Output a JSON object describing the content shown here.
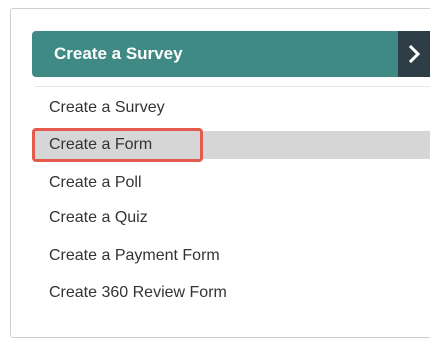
{
  "dropdown": {
    "selected_label": "Create a Survey",
    "toggle_icon": "chevron-right-icon",
    "button_color": "#3f8a84",
    "toggle_color": "#2f3e46"
  },
  "menu": {
    "items": [
      {
        "label": "Create a Survey"
      },
      {
        "label": "Create a Form",
        "selected": true
      },
      {
        "label": "Create a Poll"
      },
      {
        "label": "Create a Quiz"
      },
      {
        "label": "Create a Payment Form"
      },
      {
        "label": "Create 360 Review Form"
      }
    ],
    "highlight_color": "#d6d6d6",
    "annotation_color": "#e45a4c"
  }
}
